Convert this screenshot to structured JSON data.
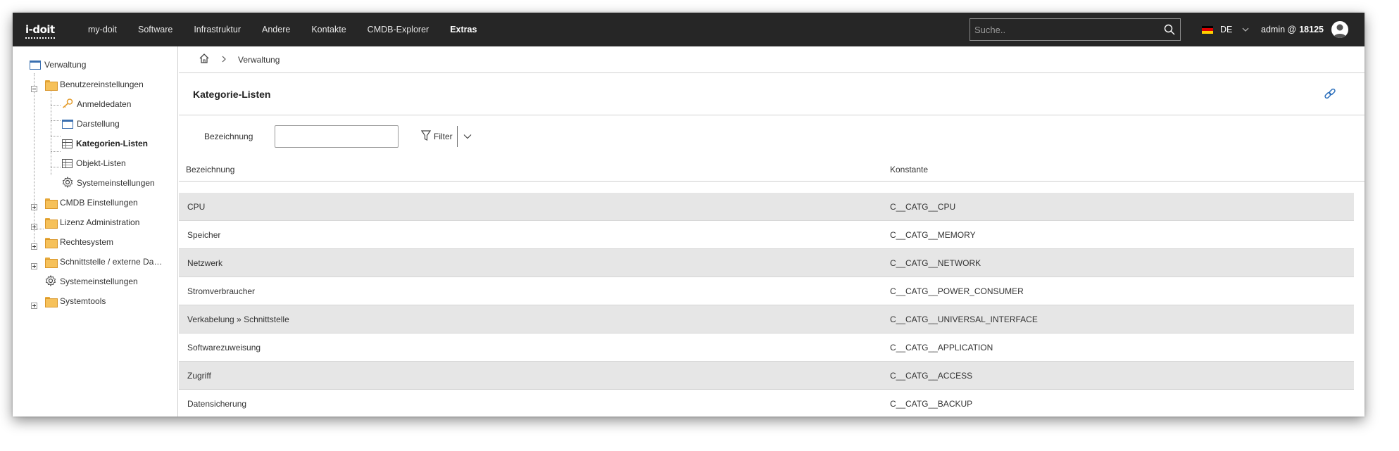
{
  "app": {
    "logo_text": "i-doit"
  },
  "topnav": {
    "items": [
      {
        "label": "my-doit"
      },
      {
        "label": "Software"
      },
      {
        "label": "Infrastruktur"
      },
      {
        "label": "Andere"
      },
      {
        "label": "Kontakte"
      },
      {
        "label": "CMDB-Explorer"
      },
      {
        "label": "Extras",
        "active": true
      }
    ],
    "search_placeholder": "Suche..",
    "language": "DE",
    "user_prefix": "admin @",
    "tenant_id": "18125"
  },
  "sidebar": {
    "root": {
      "label": "Verwaltung",
      "icon": "window-icon"
    },
    "items": [
      {
        "label": "Benutzereinstellungen",
        "icon": "folder-icon"
      },
      {
        "label": "Anmeldedaten",
        "icon": "key-icon"
      },
      {
        "label": "Darstellung",
        "icon": "window-icon"
      },
      {
        "label": "Kategorien-Listen",
        "icon": "table-icon",
        "selected": true
      },
      {
        "label": "Objekt-Listen",
        "icon": "table-icon"
      },
      {
        "label": "Systemeinstellungen",
        "icon": "gear-icon"
      },
      {
        "label": "CMDB Einstellungen",
        "icon": "folder-icon"
      },
      {
        "label": "Lizenz Administration",
        "icon": "folder-icon"
      },
      {
        "label": "Rechtesystem",
        "icon": "folder-icon"
      },
      {
        "label": "Schnittstelle / externe Da…",
        "icon": "folder-icon"
      },
      {
        "label": "Systemeinstellungen",
        "icon": "gear-icon"
      },
      {
        "label": "Systemtools",
        "icon": "folder-icon"
      }
    ]
  },
  "breadcrumb": {
    "current": "Verwaltung"
  },
  "page": {
    "title": "Kategorie-Listen"
  },
  "filter": {
    "label": "Bezeichnung",
    "value": "",
    "button_label": "Filter"
  },
  "table": {
    "columns": [
      "Bezeichnung",
      "Konstante"
    ],
    "rows": [
      [
        "CPU",
        "C__CATG__CPU"
      ],
      [
        "Speicher",
        "C__CATG__MEMORY"
      ],
      [
        "Netzwerk",
        "C__CATG__NETWORK"
      ],
      [
        "Stromverbraucher",
        "C__CATG__POWER_CONSUMER"
      ],
      [
        "Verkabelung » Schnittstelle",
        "C__CATG__UNIVERSAL_INTERFACE"
      ],
      [
        "Softwarezuweisung",
        "C__CATG__APPLICATION"
      ],
      [
        "Zugriff",
        "C__CATG__ACCESS"
      ],
      [
        "Datensicherung",
        "C__CATG__BACKUP"
      ]
    ]
  },
  "colors": {
    "topbar_bg": "#262626",
    "row_shade": "#e6e6e6",
    "link_icon": "#2a6ebb",
    "folder": "#f6c15a"
  }
}
